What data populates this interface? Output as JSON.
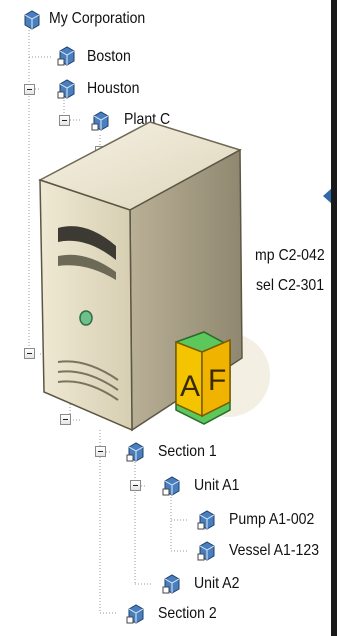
{
  "tree": {
    "nodes": [
      {
        "id": "my-corporation",
        "label": "My Corporation"
      },
      {
        "id": "boston",
        "label": "Boston"
      },
      {
        "id": "houston",
        "label": "Houston"
      },
      {
        "id": "plant",
        "label": "Plant C"
      },
      {
        "id": "pump-c2-042",
        "label": "mp C2-042"
      },
      {
        "id": "vessel-c2-301",
        "label": "sel C2-301"
      },
      {
        "id": "section-1",
        "label": "Section 1"
      },
      {
        "id": "unit-a1",
        "label": "Unit A1"
      },
      {
        "id": "pump-a1-002",
        "label": "Pump A1-002"
      },
      {
        "id": "vessel-a1-123",
        "label": "Vessel A1-123"
      },
      {
        "id": "unit-a2",
        "label": "Unit A2"
      },
      {
        "id": "section-2",
        "label": "Section 2"
      }
    ]
  },
  "overlay": {
    "icon_name": "server-af-icon",
    "badge_letters": [
      "A",
      "F"
    ]
  },
  "colors": {
    "tree_line": "#9a9a9a",
    "cube_face": "#4a7fbf",
    "accent_arrow": "#2e6aa8",
    "badge_yellow": "#f5c400",
    "badge_green": "#5cc85c",
    "server_beige": "#e6e0c8"
  }
}
